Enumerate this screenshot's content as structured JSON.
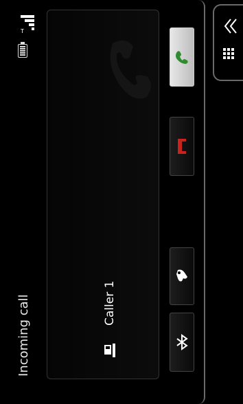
{
  "call": {
    "title": "Incoming call",
    "caller_name": "Caller 1"
  },
  "status_bar": {
    "signal_icon": "signal-icon",
    "battery_icon": "battery-icon"
  },
  "buttons": {
    "answer_icon": "answer-phone-icon",
    "reject_icon": "end-call-icon",
    "silence_icon": "silence-ringer-icon",
    "bluetooth_icon": "bluetooth-icon"
  },
  "side_tab": {
    "collapse_icon": "double-chevron-icon",
    "keypad_icon": "keypad-icon"
  },
  "colors": {
    "answer_green": "#2e8b2e",
    "reject_red": "#c8241f",
    "background": "#000000",
    "frame": "#6a6a6a"
  }
}
